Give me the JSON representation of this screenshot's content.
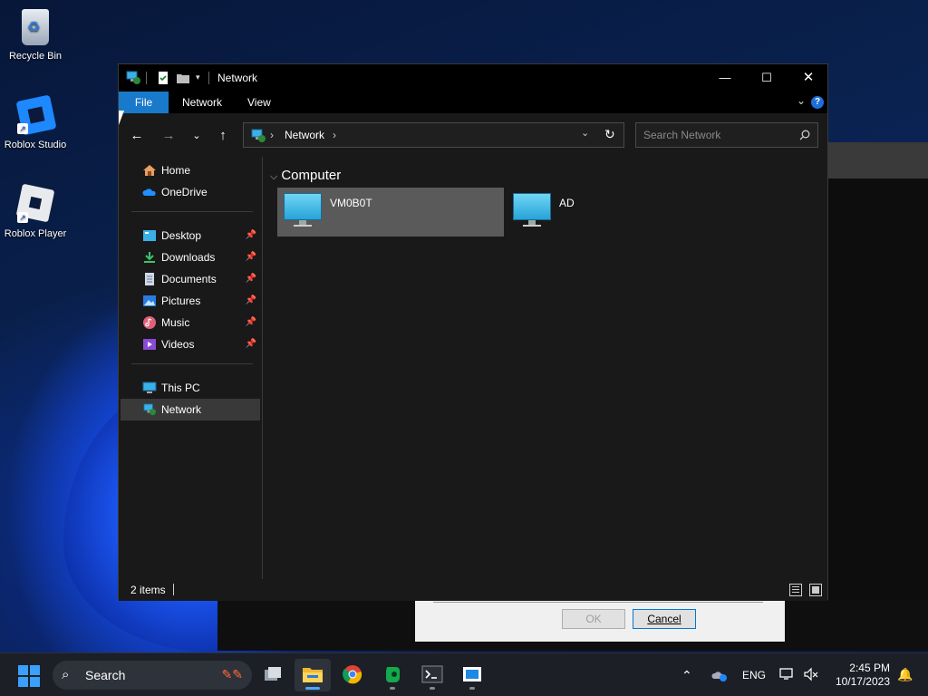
{
  "desktop": {
    "icons": [
      {
        "label": "Recycle Bin"
      },
      {
        "label": "Roblox Studio"
      },
      {
        "label": "Roblox Player"
      }
    ]
  },
  "background_dialog": {
    "ok_label": "OK",
    "cancel_label": "Cancel"
  },
  "window": {
    "title": "Network",
    "ribbon_tabs": [
      "File",
      "Network",
      "View"
    ],
    "address": {
      "crumbs": [
        "Network"
      ]
    },
    "search": {
      "placeholder": "Search Network",
      "value": ""
    },
    "sidebar": {
      "quick": [
        {
          "label": "Home"
        },
        {
          "label": "OneDrive"
        }
      ],
      "pinned": [
        {
          "label": "Desktop"
        },
        {
          "label": "Downloads"
        },
        {
          "label": "Documents"
        },
        {
          "label": "Pictures"
        },
        {
          "label": "Music"
        },
        {
          "label": "Videos"
        }
      ],
      "locations": [
        {
          "label": "This PC"
        },
        {
          "label": "Network",
          "selected": true
        }
      ]
    },
    "content": {
      "group": "Computer",
      "items": [
        {
          "name": "VM0B0T",
          "selected": true
        },
        {
          "name": "AD",
          "selected": false
        }
      ]
    },
    "status": {
      "item_count": "2 items"
    }
  },
  "taskbar": {
    "search_label": "Search",
    "language": "ENG",
    "time": "2:45 PM",
    "date": "10/17/2023"
  },
  "colors": {
    "accent": "#1979ca",
    "window_bg": "#191919",
    "selection": "#393939"
  }
}
